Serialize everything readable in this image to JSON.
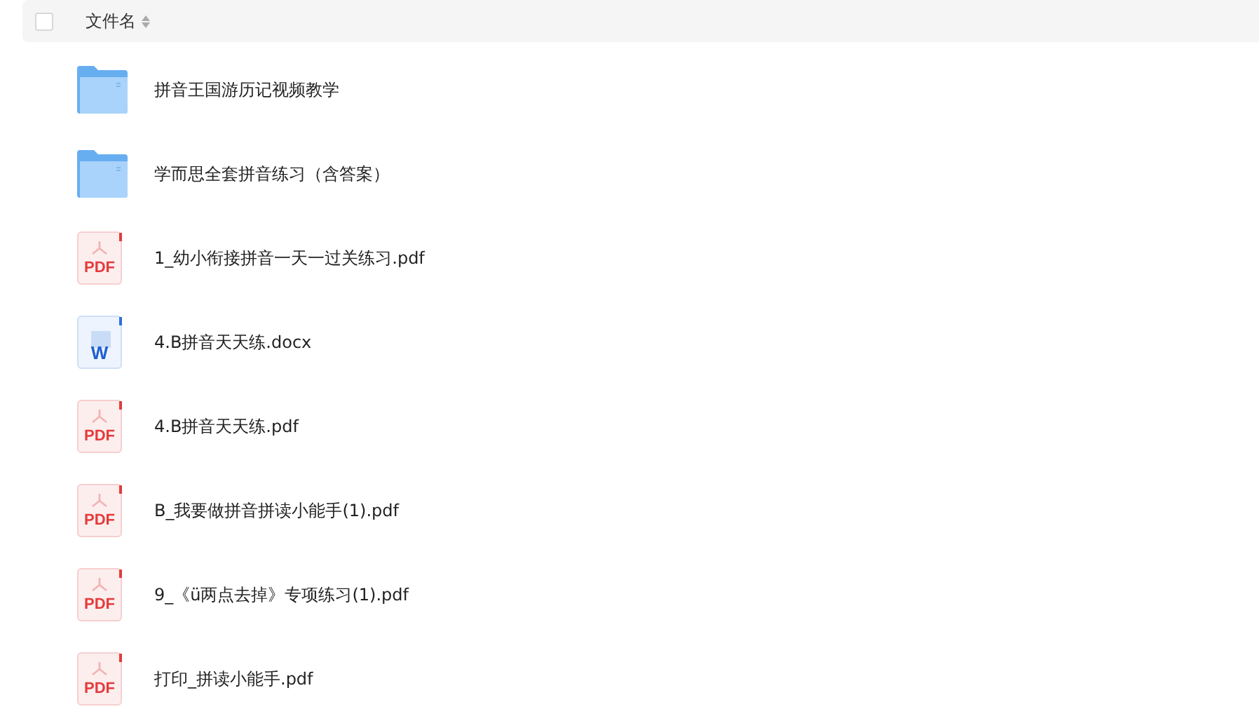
{
  "header": {
    "checked": false,
    "column": "文件名"
  },
  "files": [
    {
      "kind": "folder",
      "name": "拼音王国游历记视频教学"
    },
    {
      "kind": "folder",
      "name": "学而思全套拼音练习（含答案）"
    },
    {
      "kind": "pdf",
      "icon_label": "PDF",
      "name": "1_幼小衔接拼音一天一过关练习.pdf"
    },
    {
      "kind": "word",
      "icon_label": "W",
      "name": "4.B拼音天天练.docx"
    },
    {
      "kind": "pdf",
      "icon_label": "PDF",
      "name": "4.B拼音天天练.pdf"
    },
    {
      "kind": "pdf",
      "icon_label": "PDF",
      "name": "B_我要做拼音拼读小能手(1).pdf"
    },
    {
      "kind": "pdf",
      "icon_label": "PDF",
      "name": "9_《ü两点去掉》专项练习(1).pdf"
    },
    {
      "kind": "pdf",
      "icon_label": "PDF",
      "name": "打印_拼读小能手.pdf"
    }
  ]
}
